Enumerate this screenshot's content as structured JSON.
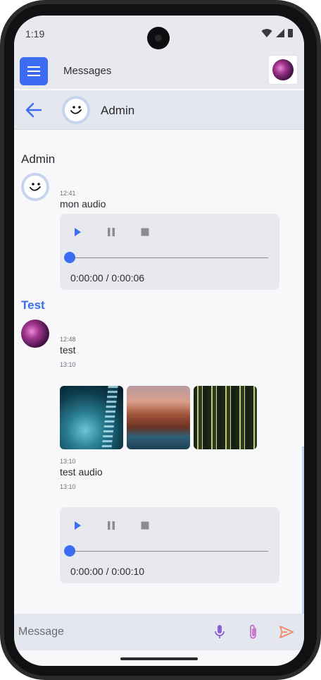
{
  "status_bar": {
    "time": "1:19"
  },
  "top_bar": {
    "title": "Messages"
  },
  "chat_header": {
    "name": "Admin"
  },
  "conversation": {
    "admin": {
      "sender": "Admin",
      "time": "12:41",
      "text": "mon audio",
      "audio": {
        "duration": "0:00:00 / 0:00:06",
        "progress": 0
      }
    },
    "test": {
      "sender": "Test",
      "time": "12:48",
      "text": "test",
      "time_2": "13:10",
      "images": [
        "dna-helix-photo",
        "coastal-rock-photo",
        "forest-trees-photo"
      ],
      "time_3": "13:10",
      "text_2": "test audio",
      "time_4": "13:10",
      "audio": {
        "duration": "0:00:00 / 0:00:10",
        "progress": 0
      }
    }
  },
  "input_bar": {
    "placeholder": "Message"
  },
  "colors": {
    "accent": "#3b6cf1",
    "mic": "#8a62d9",
    "attach": "#c06ac4",
    "send": "#f08a6b",
    "header_bg": "#e4e7ef",
    "screen_bg": "#f8f8fb"
  }
}
